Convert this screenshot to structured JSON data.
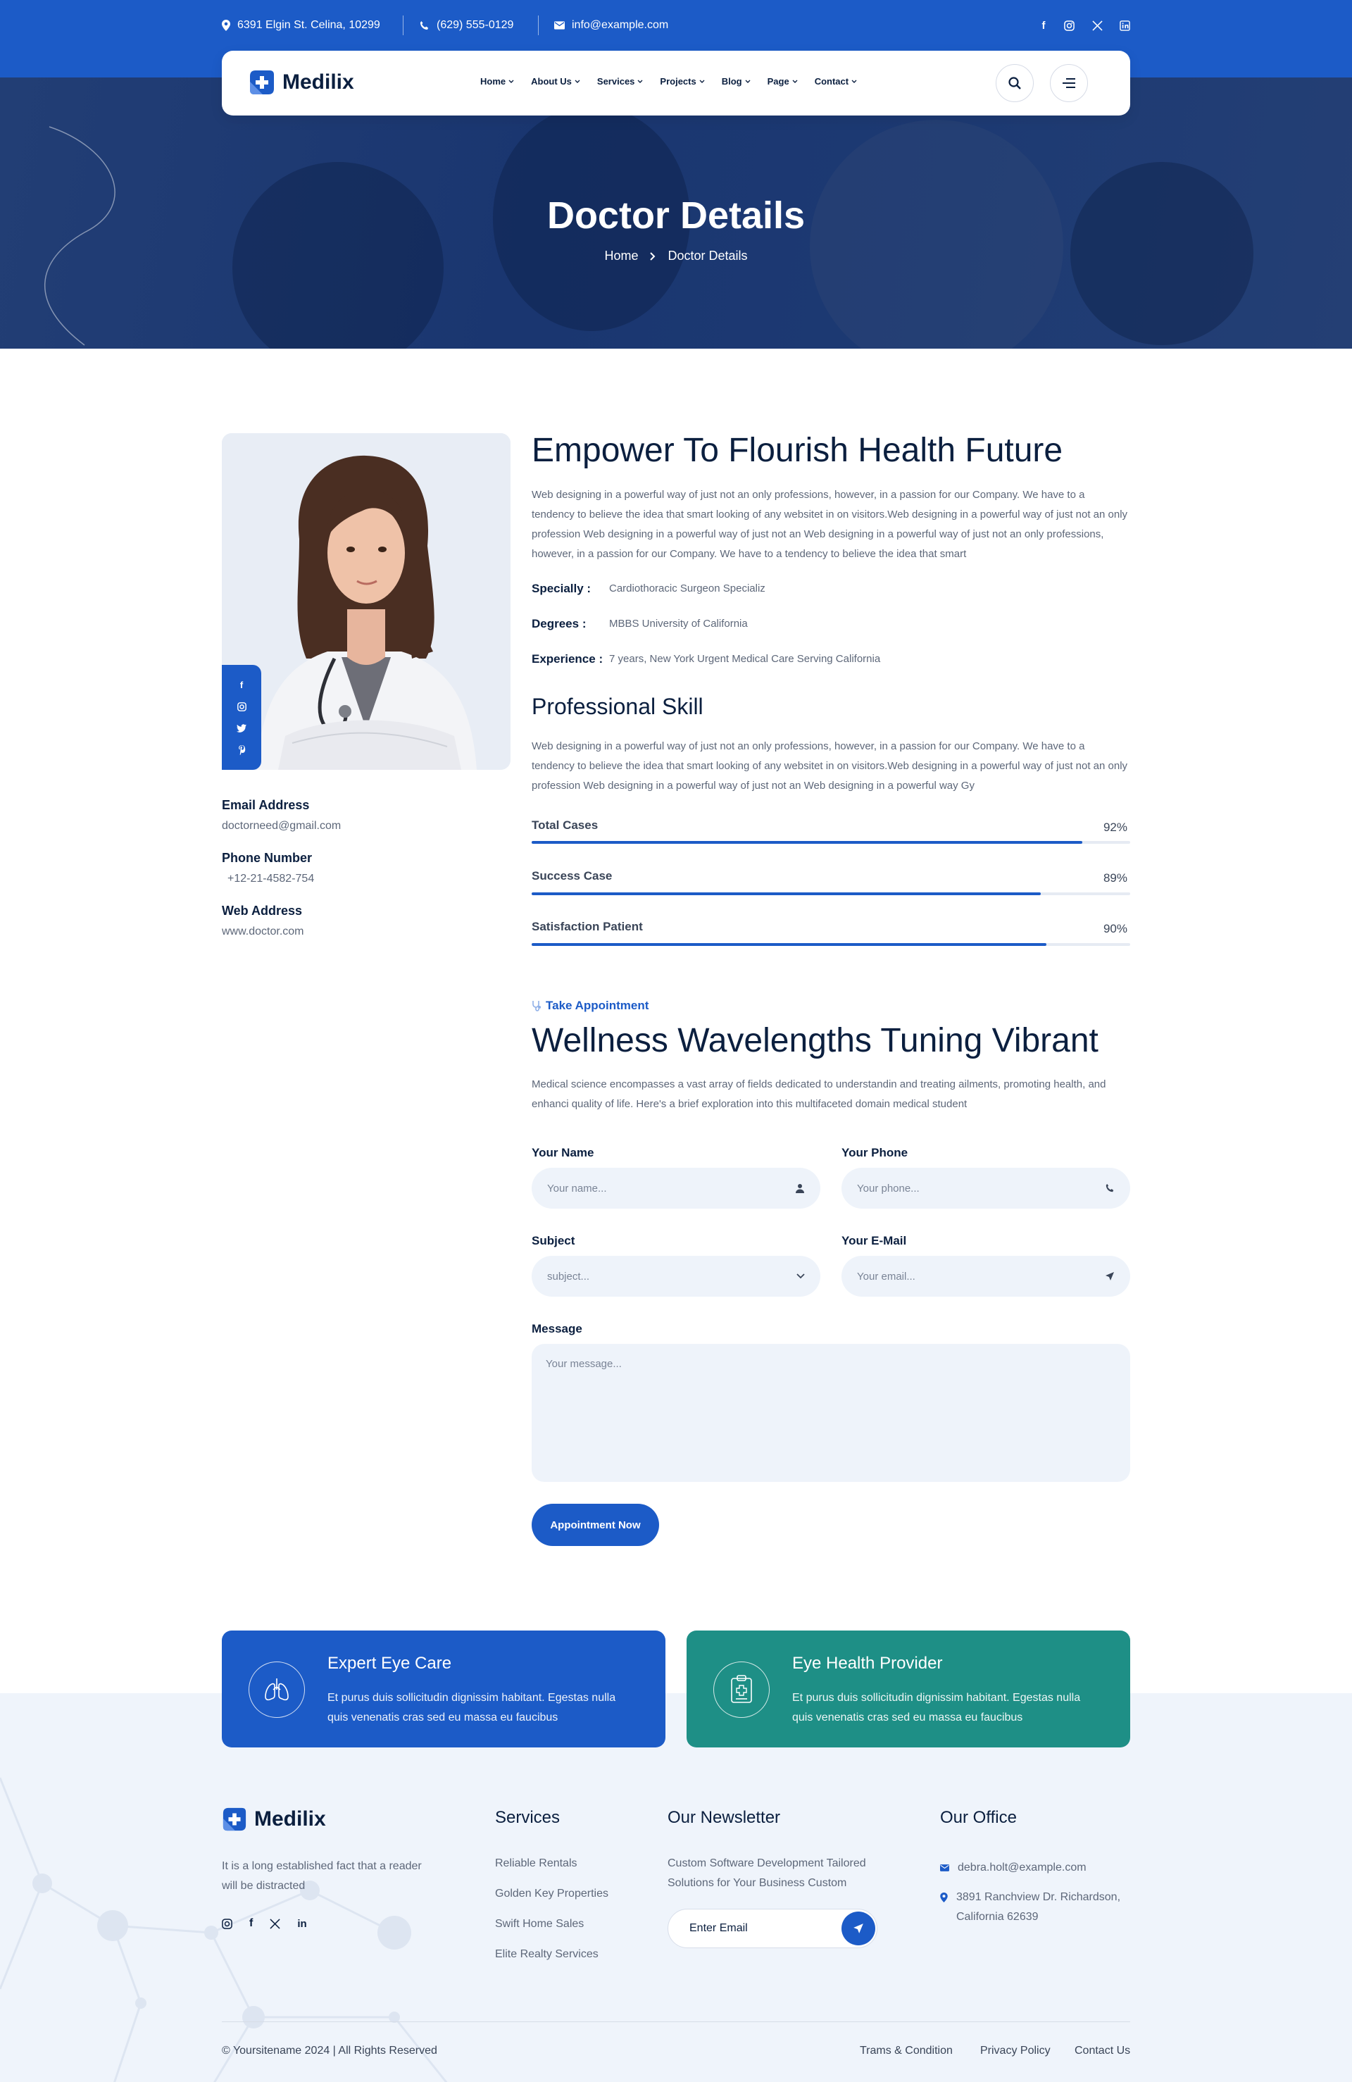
{
  "topbar": {
    "address": "6391 Elgin St. Celina, 10299",
    "phone": "(629) 555-0129",
    "email": "info@example.com",
    "social": [
      "facebook-icon",
      "instagram-icon",
      "x-icon",
      "linkedin-icon"
    ]
  },
  "brand": {
    "name": "Medilix",
    "accent": "#1c5bc7",
    "teal": "#1e8f86",
    "dark": "#0b1f3f"
  },
  "nav": {
    "items": [
      {
        "label": "Home"
      },
      {
        "label": "About Us"
      },
      {
        "label": "Services"
      },
      {
        "label": "Projects"
      },
      {
        "label": "Blog"
      },
      {
        "label": "Page"
      },
      {
        "label": "Contact"
      }
    ]
  },
  "hero": {
    "title": "Doctor Details",
    "breadcrumb": [
      "Home",
      "Doctor Details"
    ]
  },
  "doctor": {
    "email_label": "Email Address",
    "email": "doctorneed@gmail.com",
    "phone_label": "Phone Number",
    "phone": "+12-21-4582-754",
    "web_label": "Web Address",
    "web": "www.doctor.com"
  },
  "about": {
    "heading": "Empower To Flourish Health Future",
    "paragraph": "Web designing in a powerful way of just not an only professions, however, in a passion for our Company. We have to a tendency to believe the idea that smart looking of any websitet in on visitors.Web designing in a powerful way of just not an only profession Web designing in a powerful way of just not an Web designing in a powerful way of just not an only professions, however, in a passion for our Company. We have to a tendency to believe the idea that smart",
    "specialty_label": "Specially :",
    "specialty": "Cardiothoracic Surgeon Specializ",
    "degrees_label": "Degrees :",
    "degrees": "MBBS University of California",
    "experience_label": "Experience :",
    "experience": "7 years, New York Urgent Medical Care Serving California"
  },
  "skills": {
    "heading": "Professional Skill",
    "paragraph": "Web designing in a powerful way of just not an only professions, however, in a passion for our Company. We have to a tendency to believe the idea that smart looking of any websitet in on visitors.Web designing in a powerful way of just not an only profession Web designing in a powerful way of just not an Web designing in a powerful way Gy",
    "items": [
      {
        "label": "Total Cases",
        "percent": "92%",
        "value": 0.92
      },
      {
        "label": "Success Case",
        "percent": "89%",
        "value": 0.85
      },
      {
        "label": "Satisfaction Patient",
        "percent": "90%",
        "value": 0.86
      }
    ]
  },
  "appointment": {
    "eyebrow": "Take Appointment",
    "heading": "Wellness Wavelengths Tuning Vibrant",
    "paragraph": "Medical science encompasses a vast array of fields dedicated to understandin and treating ailments, promoting health, and enhanci quality of life. Here's a brief exploration into this multifaceted domain medical student",
    "name_label": "Your Name",
    "name_placeholder": "Your name...",
    "phone_label": "Your Phone",
    "phone_placeholder": "Your phone...",
    "subject_label": "Subject",
    "subject_value": "subject...",
    "email_label": "Your E-Mail",
    "email_placeholder": "Your email...",
    "message_label": "Message",
    "message_placeholder": "Your message...",
    "button": "Appointment Now"
  },
  "cards": [
    {
      "title": "Expert Eye Care",
      "text": "Et purus duis sollicitudin dignissim habitant. Egestas nulla quis venenatis cras sed eu massa eu faucibus",
      "icon": "lungs-icon"
    },
    {
      "title": "Eye Health Provider",
      "text": "Et purus duis sollicitudin dignissim habitant. Egestas nulla quis venenatis cras sed eu massa eu faucibus",
      "icon": "clipboard-medical-icon"
    }
  ],
  "footer": {
    "about": "It is a long established fact that a reader will be distracted",
    "services_title": "Services",
    "services": [
      "Reliable Rentals",
      "Golden Key Properties",
      "Swift Home Sales",
      "Elite Realty Services"
    ],
    "newsletter_title": "Our Newsletter",
    "newsletter_text": "Custom Software Development Tailored Solutions for Your Business Custom",
    "newsletter_placeholder": "Enter Email",
    "office_title": "Our Office",
    "office_email": "debra.holt@example.com",
    "office_address": "3891 Ranchview Dr. Richardson, California 62639",
    "copyright": "© Yoursitename  2024 | All Rights Reserved",
    "links": [
      "Trams & Condition",
      "Privacy Policy",
      "Contact Us"
    ]
  }
}
